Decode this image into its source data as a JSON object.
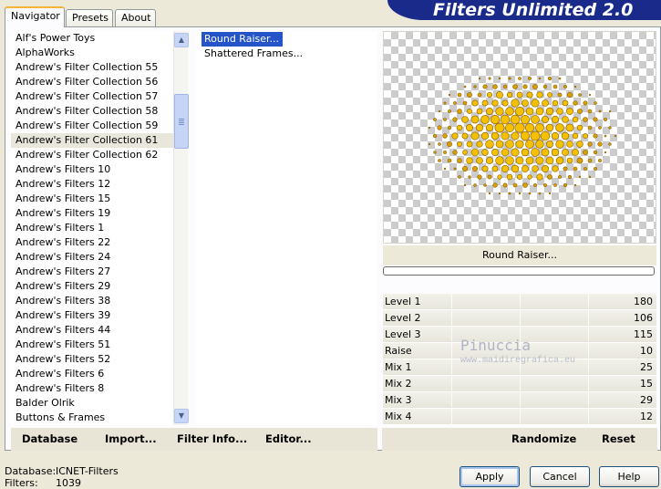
{
  "app": {
    "title": "Filters Unlimited 2.0"
  },
  "tabs": [
    {
      "label": "Navigator",
      "active": true
    },
    {
      "label": "Presets",
      "active": false
    },
    {
      "label": "About",
      "active": false
    }
  ],
  "categories": {
    "items": [
      "Alf's Power Toys",
      "AlphaWorks",
      "Andrew's Filter Collection 55",
      "Andrew's Filter Collection 56",
      "Andrew's Filter Collection 57",
      "Andrew's Filter Collection 58",
      "Andrew's Filter Collection 59",
      "Andrew's Filter Collection 61",
      "Andrew's Filter Collection 62",
      "Andrew's Filters 10",
      "Andrew's Filters 12",
      "Andrew's Filters 15",
      "Andrew's Filters 19",
      "Andrew's Filters 1",
      "Andrew's Filters 22",
      "Andrew's Filters 24",
      "Andrew's Filters 27",
      "Andrew's Filters 29",
      "Andrew's Filters 38",
      "Andrew's Filters 39",
      "Andrew's Filters 44",
      "Andrew's Filters 51",
      "Andrew's Filters 52",
      "Andrew's Filters 6",
      "Andrew's Filters 8",
      "Balder Olrik",
      "Buttons & Frames"
    ],
    "selected_index": 7
  },
  "filters": {
    "items": [
      "Round Raiser...",
      "Shattered Frames..."
    ],
    "selected_index": 0
  },
  "left_bar": {
    "database": "Database",
    "import": "Import...",
    "filter_info": "Filter Info...",
    "editor": "Editor..."
  },
  "preview": {
    "filter_name": "Round Raiser..."
  },
  "params": [
    {
      "label": "Level 1",
      "value": "180"
    },
    {
      "label": "Level 2",
      "value": "106"
    },
    {
      "label": "Level 3",
      "value": "115"
    },
    {
      "label": "Raise",
      "value": "10"
    },
    {
      "label": "Mix 1",
      "value": "25"
    },
    {
      "label": "Mix 2",
      "value": "15"
    },
    {
      "label": "Mix 3",
      "value": "29"
    },
    {
      "label": "Mix 4",
      "value": "12"
    }
  ],
  "right_bar": {
    "randomize": "Randomize",
    "reset": "Reset"
  },
  "watermark": {
    "name": "Pinuccia",
    "site": "www.maidiregrafica.eu"
  },
  "status": {
    "database_label": "Database:",
    "database_value": "ICNET-Filters",
    "filters_label": "Filters:",
    "filters_value": "1039"
  },
  "buttons": {
    "apply": "Apply",
    "cancel": "Cancel",
    "help": "Help"
  },
  "colors": {
    "banner": "#1a2a8a",
    "selection": "#2454c8",
    "accent_tab": "#f8b33b"
  }
}
